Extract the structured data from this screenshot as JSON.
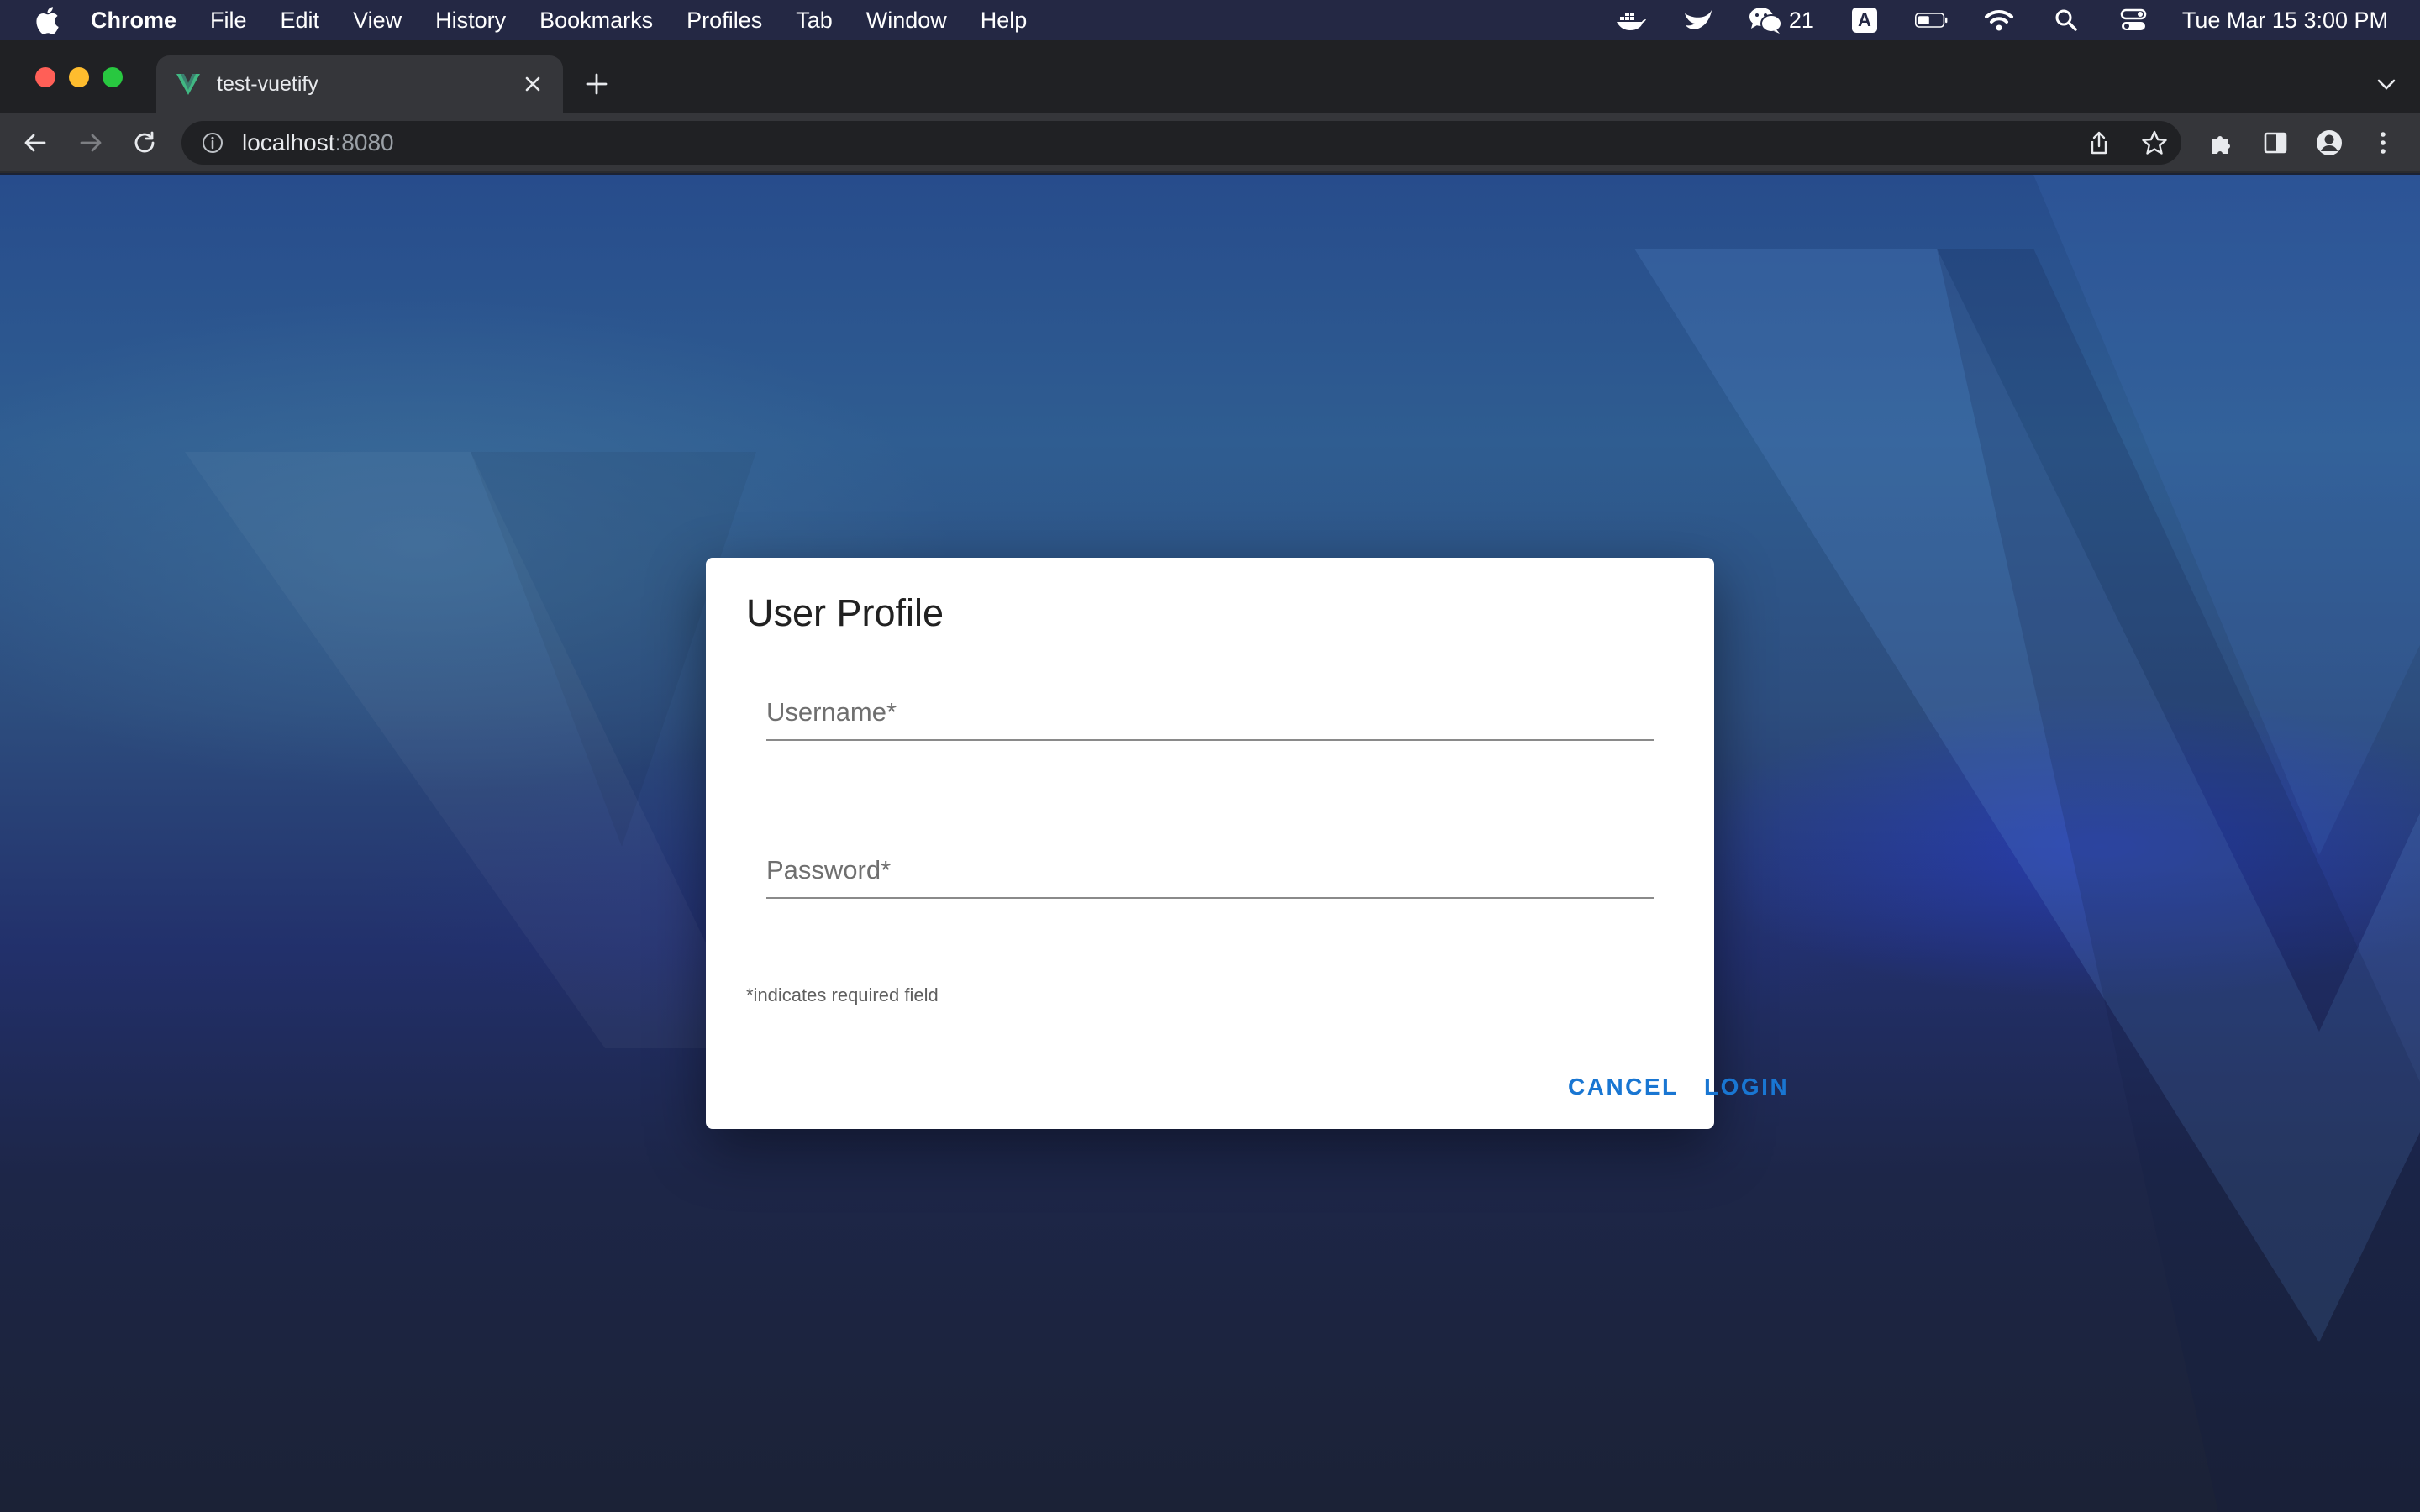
{
  "menubar": {
    "apple_icon": "apple-logo-icon",
    "items": [
      "Chrome",
      "File",
      "Edit",
      "View",
      "History",
      "Bookmarks",
      "Profiles",
      "Tab",
      "Window",
      "Help"
    ],
    "status": {
      "wechat_count": "21",
      "input_source": "A",
      "clock": "Tue Mar 15  3:00 PM"
    }
  },
  "browser": {
    "tab": {
      "title": "test-vuetify",
      "favicon": "vuetify-v-icon"
    },
    "url": {
      "host": "localhost",
      "port": ":8080"
    },
    "colors": {
      "chrome_dark": "#202124",
      "toolbar": "#35363a"
    }
  },
  "dialog": {
    "title": "User Profile",
    "username_label": "Username*",
    "password_label": "Password*",
    "required_note": "*indicates required field",
    "cancel_label": "CANCEL",
    "login_label": "LOGIN",
    "accent_color": "#1976d2"
  }
}
